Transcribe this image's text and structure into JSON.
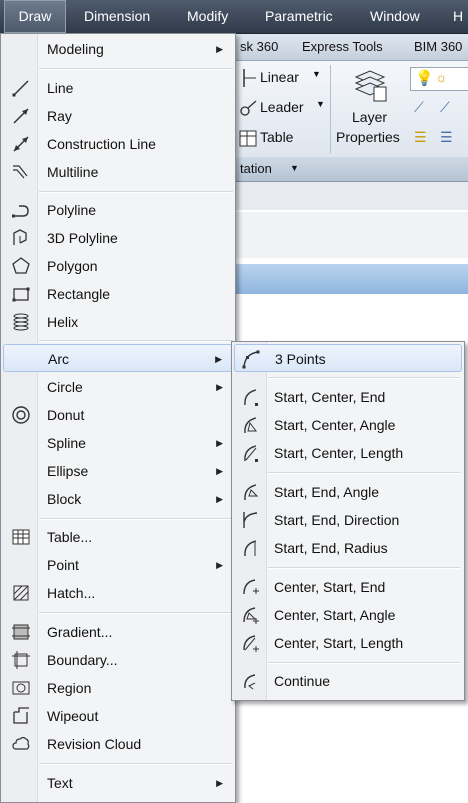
{
  "menubar": {
    "items": [
      "Draw",
      "Dimension",
      "Modify",
      "Parametric",
      "Window",
      "H"
    ]
  },
  "ribbon": {
    "tabs": [
      "sk 360",
      "Express Tools",
      "BIM 360"
    ],
    "linear_label": "Linear",
    "leader_label": "Leader",
    "table_label": "Table",
    "panel_title": "tation",
    "layer_properties_line1": "Layer",
    "layer_properties_line2": "Properties",
    "toolbar_help": "?"
  },
  "draw_menu": {
    "modeling": "Modeling",
    "line": "Line",
    "ray": "Ray",
    "construction_line": "Construction Line",
    "multiline": "Multiline",
    "polyline": "Polyline",
    "polyline_3d": "3D Polyline",
    "polygon": "Polygon",
    "rectangle": "Rectangle",
    "helix": "Helix",
    "arc": "Arc",
    "circle": "Circle",
    "donut": "Donut",
    "spline": "Spline",
    "ellipse": "Ellipse",
    "block": "Block",
    "table": "Table...",
    "point": "Point",
    "hatch": "Hatch...",
    "gradient": "Gradient...",
    "boundary": "Boundary...",
    "region": "Region",
    "wipeout": "Wipeout",
    "revision_cloud": "Revision Cloud",
    "text": "Text"
  },
  "arc_menu": {
    "three_points": "3 Points",
    "start_center_end": "Start, Center, End",
    "start_center_angle": "Start, Center, Angle",
    "start_center_length": "Start, Center, Length",
    "start_end_angle": "Start, End, Angle",
    "start_end_direction": "Start, End, Direction",
    "start_end_radius": "Start, End, Radius",
    "center_start_end": "Center, Start, End",
    "center_start_angle": "Center, Start, Angle",
    "center_start_length": "Center, Start, Length",
    "continue": "Continue"
  },
  "icons": {
    "submenu_arrow": "submenu-arrow-icon",
    "dropdown": "dropdown-arrow-icon"
  }
}
